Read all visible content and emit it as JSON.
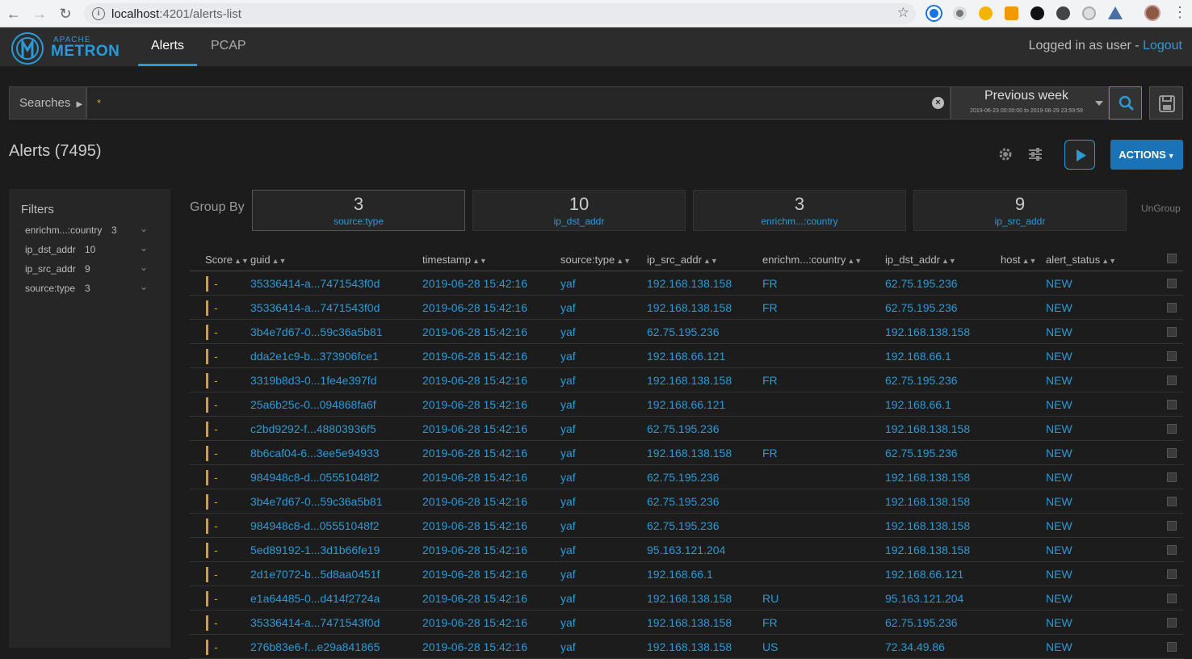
{
  "browser": {
    "url_host": "localhost",
    "url_rest": ":4201/alerts-list"
  },
  "header": {
    "logo_small": "APACHE",
    "logo_big": "METRON",
    "tabs": [
      {
        "label": "Alerts"
      },
      {
        "label": "PCAP"
      }
    ],
    "user_prefix": "Logged in as user - ",
    "logout_label": "Logout"
  },
  "search": {
    "searches_label": "Searches",
    "query": "*",
    "time_label": "Previous week",
    "time_range": "2019-06-23 00:00:00 to 2019-06-29 23:59:59"
  },
  "alerts": {
    "title": "Alerts (7495)",
    "actions_label": "ACTIONS"
  },
  "filters": {
    "title": "Filters",
    "items": [
      {
        "name": "enrichm...:country",
        "count": "3"
      },
      {
        "name": "ip_dst_addr",
        "count": "10"
      },
      {
        "name": "ip_src_addr",
        "count": "9"
      },
      {
        "name": "source:type",
        "count": "3"
      }
    ]
  },
  "groupby": {
    "label": "Group By",
    "ungroup_label": "UnGroup",
    "cards": [
      {
        "count": "3",
        "name": "source:type"
      },
      {
        "count": "10",
        "name": "ip_dst_addr"
      },
      {
        "count": "3",
        "name": "enrichm...:country"
      },
      {
        "count": "9",
        "name": "ip_src_addr"
      }
    ]
  },
  "table": {
    "columns": [
      "Score",
      "guid",
      "timestamp",
      "source:type",
      "ip_src_addr",
      "enrichm...:country",
      "ip_dst_addr",
      "host",
      "alert_status"
    ],
    "rows": [
      {
        "score": "-",
        "guid": "35336414-a...7471543f0d",
        "timestamp": "2019-06-28 15:42:16",
        "type": "yaf",
        "src": "192.168.138.158",
        "country": "FR",
        "dst": "62.75.195.236",
        "host": "",
        "status": "NEW"
      },
      {
        "score": "-",
        "guid": "35336414-a...7471543f0d",
        "timestamp": "2019-06-28 15:42:16",
        "type": "yaf",
        "src": "192.168.138.158",
        "country": "FR",
        "dst": "62.75.195.236",
        "host": "",
        "status": "NEW"
      },
      {
        "score": "-",
        "guid": "3b4e7d67-0...59c36a5b81",
        "timestamp": "2019-06-28 15:42:16",
        "type": "yaf",
        "src": "62.75.195.236",
        "country": "",
        "dst": "192.168.138.158",
        "host": "",
        "status": "NEW"
      },
      {
        "score": "-",
        "guid": "dda2e1c9-b...373906fce1",
        "timestamp": "2019-06-28 15:42:16",
        "type": "yaf",
        "src": "192.168.66.121",
        "country": "",
        "dst": "192.168.66.1",
        "host": "",
        "status": "NEW"
      },
      {
        "score": "-",
        "guid": "3319b8d3-0...1fe4e397fd",
        "timestamp": "2019-06-28 15:42:16",
        "type": "yaf",
        "src": "192.168.138.158",
        "country": "FR",
        "dst": "62.75.195.236",
        "host": "",
        "status": "NEW"
      },
      {
        "score": "-",
        "guid": "25a6b25c-0...094868fa6f",
        "timestamp": "2019-06-28 15:42:16",
        "type": "yaf",
        "src": "192.168.66.121",
        "country": "",
        "dst": "192.168.66.1",
        "host": "",
        "status": "NEW"
      },
      {
        "score": "-",
        "guid": "c2bd9292-f...48803936f5",
        "timestamp": "2019-06-28 15:42:16",
        "type": "yaf",
        "src": "62.75.195.236",
        "country": "",
        "dst": "192.168.138.158",
        "host": "",
        "status": "NEW"
      },
      {
        "score": "-",
        "guid": "8b6caf04-6...3ee5e94933",
        "timestamp": "2019-06-28 15:42:16",
        "type": "yaf",
        "src": "192.168.138.158",
        "country": "FR",
        "dst": "62.75.195.236",
        "host": "",
        "status": "NEW"
      },
      {
        "score": "-",
        "guid": "984948c8-d...05551048f2",
        "timestamp": "2019-06-28 15:42:16",
        "type": "yaf",
        "src": "62.75.195.236",
        "country": "",
        "dst": "192.168.138.158",
        "host": "",
        "status": "NEW"
      },
      {
        "score": "-",
        "guid": "3b4e7d67-0...59c36a5b81",
        "timestamp": "2019-06-28 15:42:16",
        "type": "yaf",
        "src": "62.75.195.236",
        "country": "",
        "dst": "192.168.138.158",
        "host": "",
        "status": "NEW"
      },
      {
        "score": "-",
        "guid": "984948c8-d...05551048f2",
        "timestamp": "2019-06-28 15:42:16",
        "type": "yaf",
        "src": "62.75.195.236",
        "country": "",
        "dst": "192.168.138.158",
        "host": "",
        "status": "NEW"
      },
      {
        "score": "-",
        "guid": "5ed89192-1...3d1b66fe19",
        "timestamp": "2019-06-28 15:42:16",
        "type": "yaf",
        "src": "95.163.121.204",
        "country": "",
        "dst": "192.168.138.158",
        "host": "",
        "status": "NEW"
      },
      {
        "score": "-",
        "guid": "2d1e7072-b...5d8aa0451f",
        "timestamp": "2019-06-28 15:42:16",
        "type": "yaf",
        "src": "192.168.66.1",
        "country": "",
        "dst": "192.168.66.121",
        "host": "",
        "status": "NEW"
      },
      {
        "score": "-",
        "guid": "e1a64485-0...d414f2724a",
        "timestamp": "2019-06-28 15:42:16",
        "type": "yaf",
        "src": "192.168.138.158",
        "country": "RU",
        "dst": "95.163.121.204",
        "host": "",
        "status": "NEW"
      },
      {
        "score": "-",
        "guid": "35336414-a...7471543f0d",
        "timestamp": "2019-06-28 15:42:16",
        "type": "yaf",
        "src": "192.168.138.158",
        "country": "FR",
        "dst": "62.75.195.236",
        "host": "",
        "status": "NEW"
      },
      {
        "score": "-",
        "guid": "276b83e6-f...e29a841865",
        "timestamp": "2019-06-28 15:42:16",
        "type": "yaf",
        "src": "192.168.138.158",
        "country": "US",
        "dst": "72.34.49.86",
        "host": "",
        "status": "NEW"
      }
    ]
  },
  "colors": {
    "accent": "#2a9ad6",
    "score_bar": "#c8a33a",
    "background": "#1c1c1c"
  }
}
